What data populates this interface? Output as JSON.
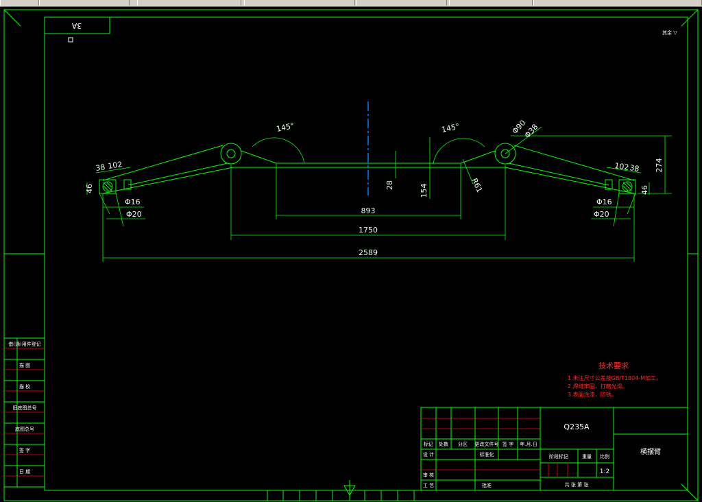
{
  "drawing": {
    "stamp": "3A",
    "corner_note": "其余 ▽",
    "dimensions": {
      "d893": "893",
      "d1750": "1750",
      "d2589": "2589",
      "d28": "28",
      "d154": "154",
      "d274": "274",
      "r61": "R61",
      "ang_left": "145°",
      "ang_right": "145°",
      "phi90": "Φ90",
      "phi38": "Φ38",
      "left_38": "38",
      "left_102": "102",
      "right_102": "102",
      "right_38": "38",
      "left_phi16": "Φ16",
      "left_phi20": "Φ20",
      "right_phi16": "Φ16",
      "right_phi20": "Φ20",
      "left_46": "46",
      "right_46": "46"
    }
  },
  "tech_requirements": {
    "title": "技术要求",
    "items": [
      "1.未注尺寸公差按GB/T1804-M加工。",
      "2.焊缝牢固，打磨光滑。",
      "3.表面涂漆，防锈。"
    ]
  },
  "left_strip": {
    "labels": [
      "借(通)用件登记",
      "描 图",
      "描 校",
      "旧底图总号",
      "底图总号",
      "签 字",
      "日 期"
    ]
  },
  "title_block": {
    "material": "Q235A",
    "part_name": "横摆臂",
    "row_labels": [
      "标记",
      "处数",
      "分区",
      "更改文件号",
      "签 字",
      "年.月.日"
    ],
    "designer": "设 计",
    "standardization": "标准化",
    "checker": "审 核",
    "process": "工 艺",
    "approve": "批准",
    "stage_mark": "阶段标记",
    "weight": "重量",
    "scale_label": "比例",
    "scale_value": "1:2",
    "sheets": "共   张   第   张"
  },
  "colors": {
    "line": "#00ff00",
    "red": "#ff0000",
    "text": "#ffffff",
    "axis": "#0080ff"
  }
}
